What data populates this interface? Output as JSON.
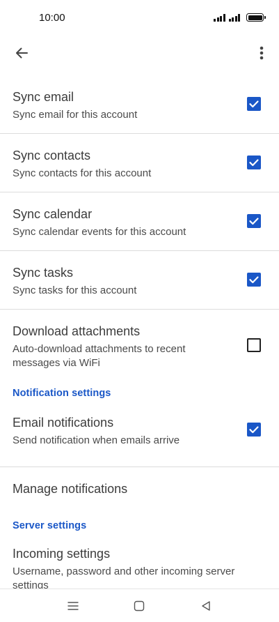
{
  "status_bar": {
    "time": "10:00"
  },
  "app_bar": {
    "back_icon": "arrow-back-icon",
    "more_icon": "more-vert-icon"
  },
  "settings": {
    "sync_email": {
      "title": "Sync email",
      "subtitle": "Sync email for this account",
      "checked": true
    },
    "sync_contacts": {
      "title": "Sync contacts",
      "subtitle": "Sync contacts for this account",
      "checked": true
    },
    "sync_calendar": {
      "title": "Sync calendar",
      "subtitle": "Sync calendar events for this account",
      "checked": true
    },
    "sync_tasks": {
      "title": "Sync tasks",
      "subtitle": "Sync tasks for this account",
      "checked": true
    },
    "download_attachments": {
      "title": "Download attachments",
      "subtitle": "Auto-download attachments to recent messages via WiFi",
      "checked": false
    }
  },
  "notification_section": {
    "header": "Notification settings",
    "email_notifications": {
      "title": "Email notifications",
      "subtitle": "Send notification when emails arrive",
      "checked": true
    },
    "manage_notifications": {
      "title": "Manage notifications"
    }
  },
  "server_section": {
    "header": "Server settings",
    "incoming_settings": {
      "title": "Incoming settings",
      "subtitle": "Username, password and other incoming server settings"
    }
  },
  "colors": {
    "accent": "#1a57c7",
    "divider": "#dcdcdc"
  },
  "nav_bar": {
    "menu_icon": "menu-icon",
    "home_icon": "square-home-icon",
    "back_icon": "triangle-back-icon"
  }
}
